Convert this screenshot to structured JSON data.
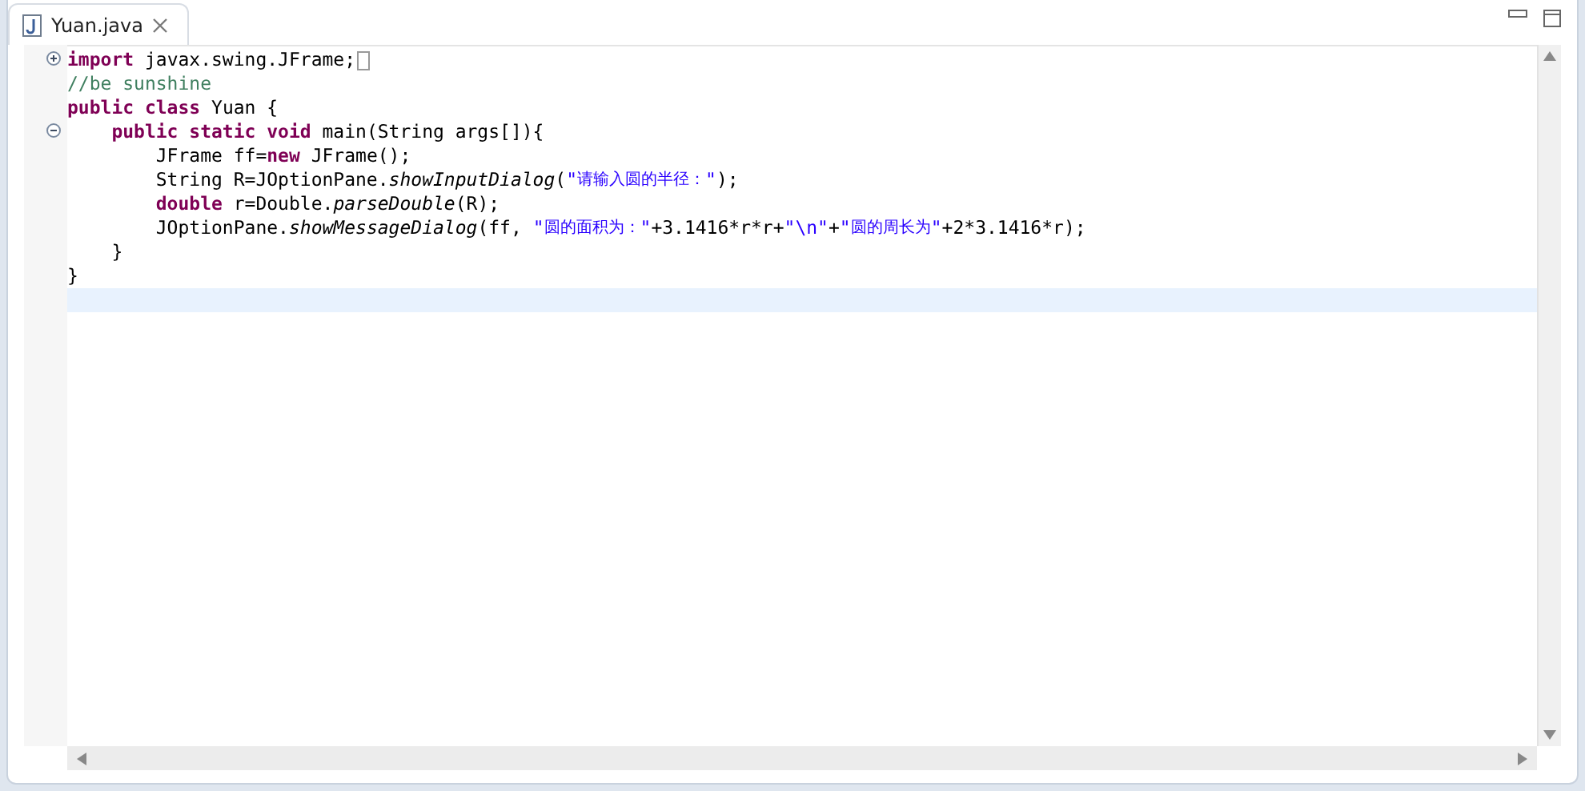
{
  "tab": {
    "title": "Yuan.java",
    "selected": true
  },
  "editor": {
    "lines": [
      {
        "foldable": true,
        "collapsed": true,
        "current": false,
        "tokens": [
          {
            "kind": "keyword",
            "text": "import"
          },
          {
            "kind": "plain",
            "text": " javax.swing.JFrame;"
          }
        ]
      },
      {
        "current": false,
        "tokens": [
          {
            "kind": "comment",
            "text": "//be sunshine"
          }
        ]
      },
      {
        "current": false,
        "tokens": [
          {
            "kind": "keyword",
            "text": "public class"
          },
          {
            "kind": "plain",
            "text": " Yuan {"
          }
        ]
      },
      {
        "foldable": true,
        "collapsed": false,
        "current": false,
        "tokens": [
          {
            "kind": "keyword",
            "text": "    public static void"
          },
          {
            "kind": "plain",
            "text": " main(String args[]){"
          }
        ]
      },
      {
        "current": false,
        "tokens": [
          {
            "kind": "plain",
            "text": "        JFrame ff="
          },
          {
            "kind": "keyword",
            "text": "new"
          },
          {
            "kind": "plain",
            "text": " JFrame();"
          }
        ]
      },
      {
        "current": false,
        "tokens": [
          {
            "kind": "plain",
            "text": "        String R=JOptionPane."
          },
          {
            "kind": "method",
            "text": "showInputDialog"
          },
          {
            "kind": "plain",
            "text": "("
          },
          {
            "kind": "string",
            "text": "\""
          },
          {
            "kind": "string_cjk",
            "text": "请输入圆的半径："
          },
          {
            "kind": "string",
            "text": "\""
          },
          {
            "kind": "plain",
            "text": ");"
          }
        ]
      },
      {
        "current": false,
        "tokens": [
          {
            "kind": "keyword",
            "text": "        double"
          },
          {
            "kind": "plain",
            "text": " r=Double."
          },
          {
            "kind": "method",
            "text": "parseDouble"
          },
          {
            "kind": "plain",
            "text": "(R);"
          }
        ]
      },
      {
        "current": false,
        "tokens": [
          {
            "kind": "plain",
            "text": "        JOptionPane."
          },
          {
            "kind": "method",
            "text": "showMessageDialog"
          },
          {
            "kind": "plain",
            "text": "(ff, "
          },
          {
            "kind": "string",
            "text": "\""
          },
          {
            "kind": "string_cjk",
            "text": "圆的面积为："
          },
          {
            "kind": "string",
            "text": "\""
          },
          {
            "kind": "plain",
            "text": "+3.1416*r*r+"
          },
          {
            "kind": "string",
            "text": "\"\\n\""
          },
          {
            "kind": "plain",
            "text": "+"
          },
          {
            "kind": "string",
            "text": "\""
          },
          {
            "kind": "string_cjk",
            "text": "圆的周长为"
          },
          {
            "kind": "string",
            "text": "\""
          },
          {
            "kind": "plain",
            "text": "+2*3.1416*r);"
          }
        ]
      },
      {
        "current": false,
        "tokens": [
          {
            "kind": "plain",
            "text": "    }"
          }
        ]
      },
      {
        "current": false,
        "tokens": [
          {
            "kind": "plain",
            "text": "}"
          }
        ]
      },
      {
        "current": true
      }
    ]
  }
}
